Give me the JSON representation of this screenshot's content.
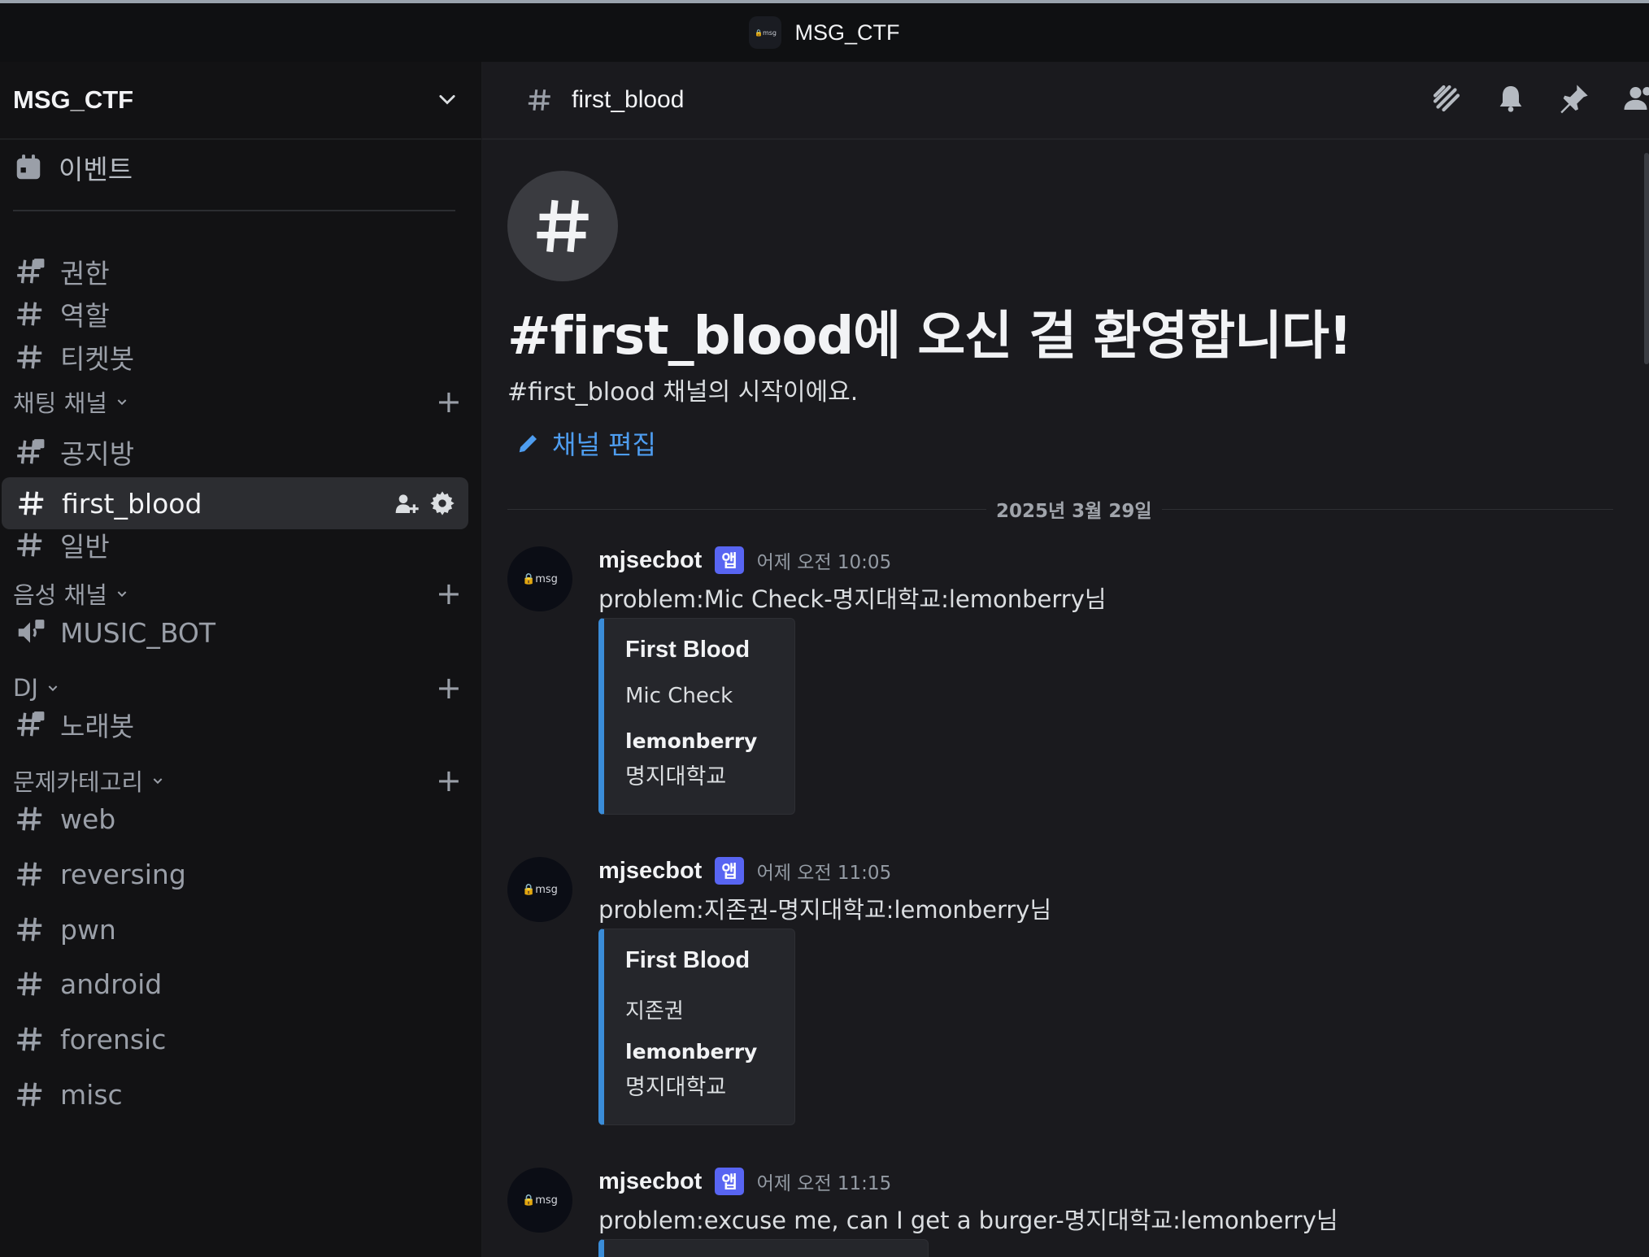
{
  "window": {
    "title": "MSG_CTF",
    "server_icon_text": "🔒msg"
  },
  "sidebar": {
    "server_name": "MSG_CTF",
    "events_label": "이벤트",
    "channels_top": [
      {
        "label": "권한",
        "icon": "hash-lock-icon"
      },
      {
        "label": "역할",
        "icon": "hash-icon"
      },
      {
        "label": "티켓봇",
        "icon": "hash-icon"
      }
    ],
    "categories": {
      "chat": "채팅 채널",
      "voice": "음성 채널",
      "dj": "DJ",
      "problems": "문제카테고리"
    },
    "chat_channels": [
      {
        "label": "공지방",
        "icon": "hash-lock-icon"
      },
      {
        "label": "first_blood",
        "icon": "hash-icon",
        "active": true
      },
      {
        "label": "일반",
        "icon": "hash-icon"
      }
    ],
    "voice_channels": [
      {
        "label": "MUSIC_BOT",
        "icon": "speaker-lock-icon"
      }
    ],
    "dj_channels": [
      {
        "label": "노래봇",
        "icon": "hash-lock-icon"
      }
    ],
    "problem_channels": [
      {
        "label": "web"
      },
      {
        "label": "reversing"
      },
      {
        "label": "pwn"
      },
      {
        "label": "android"
      },
      {
        "label": "forensic"
      },
      {
        "label": "misc"
      }
    ]
  },
  "channel": {
    "name": "first_blood",
    "welcome_title": "#first_blood에 오신 걸 환영합니다!",
    "welcome_sub": "#first_blood 채널의 시작이에요.",
    "edit_label": "채널 편집",
    "date_divider": "2025년 3월 29일"
  },
  "messages": [
    {
      "author": "mjsecbot",
      "badge": "앱",
      "time": "어제 오전 10:05",
      "body": "problem:Mic Check-명지대학교:lemonberry님",
      "avatar_text": "🔒msg",
      "embed": {
        "title": "First Blood",
        "desc": "Mic Check",
        "user": "lemonberry",
        "school": "명지대학교"
      }
    },
    {
      "author": "mjsecbot",
      "badge": "앱",
      "time": "어제 오전 11:05",
      "body": "problem:지존권-명지대학교:lemonberry님",
      "avatar_text": "🔒msg",
      "embed": {
        "title": "First Blood",
        "desc": "지존권",
        "user": "lemonberry",
        "school": "명지대학교"
      }
    },
    {
      "author": "mjsecbot",
      "badge": "앱",
      "time": "어제 오전 11:15",
      "body": "problem:excuse me, can I get a burger-명지대학교:lemonberry님",
      "avatar_text": "🔒msg"
    }
  ],
  "colors": {
    "accent_blue": "#4e9df0",
    "embed_bar": "#3a8cd8",
    "app_badge": "#5865f2"
  }
}
